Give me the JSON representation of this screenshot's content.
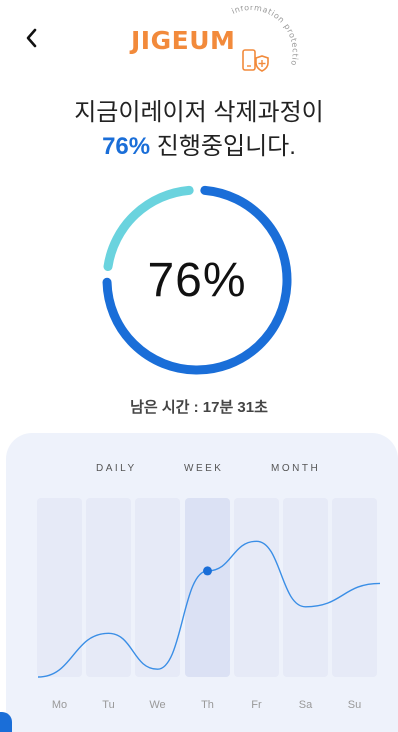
{
  "header": {
    "back_icon": "chevron-left-icon",
    "logo_text": "JIGEUM",
    "logo_arc_text": "information protection",
    "logo_icon": "phone-shield-icon",
    "brand_color": "#f28a3b"
  },
  "status": {
    "title_line1": "지금이레이저 삭제과정이",
    "title_percent": "76%",
    "title_suffix": " 진행중입니다.",
    "progress_percent": 76,
    "progress_label": "76%",
    "remaining_time": "남은 시간 : 17분 31초",
    "accent_color": "#1a6ed8",
    "ring_secondary_color": "#6ad3de"
  },
  "chart": {
    "tabs": [
      "DAILY",
      "WEEK",
      "MONTH"
    ],
    "selected_tab": "WEEK",
    "card_color": "#eef2fb"
  },
  "chart_data": {
    "type": "line",
    "categories": [
      "Mo",
      "Tu",
      "We",
      "Th",
      "Fr",
      "Sa",
      "Su"
    ],
    "series": [
      {
        "values": [
          0.0,
          0.28,
          0.05,
          0.68,
          0.87,
          0.45,
          0.6
        ]
      }
    ],
    "ylim": [
      0,
      1
    ],
    "highlighted_category": "Th",
    "grid": false,
    "line_color": "#3a8ee6"
  }
}
